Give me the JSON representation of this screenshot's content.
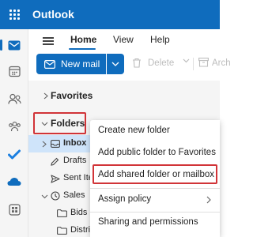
{
  "app": {
    "title": "Outlook"
  },
  "ribbon": {
    "tabs": [
      {
        "label": "Home",
        "selected": true
      },
      {
        "label": "View",
        "selected": false
      },
      {
        "label": "Help",
        "selected": false
      }
    ],
    "new_mail_label": "New mail",
    "delete_label": "Delete",
    "archive_label": "Arch"
  },
  "rail": {
    "items": [
      "mail-icon",
      "calendar-icon",
      "people-icon",
      "groups-icon",
      "todo-icon",
      "onedrive-icon",
      "apps-icon"
    ]
  },
  "folders": {
    "favorites_label": "Favorites",
    "folders_label": "Folders",
    "items": [
      {
        "label": "Inbox",
        "icon": "inbox-icon",
        "selected": true
      },
      {
        "label": "Drafts",
        "icon": "pencil-icon"
      },
      {
        "label": "Sent Items",
        "icon": "send-icon"
      },
      {
        "label": "Sales",
        "icon": "clock-icon"
      },
      {
        "label": "Bids - G",
        "icon": "folder-icon"
      },
      {
        "label": "Distribu",
        "icon": "folder-icon"
      }
    ]
  },
  "context_menu": {
    "items": [
      {
        "label": "Create new folder"
      },
      {
        "label": "Add public folder to Favorites"
      },
      {
        "label": "Add shared folder or mailbox",
        "highlighted": true
      },
      {
        "label": "Assign policy",
        "has_submenu": true
      },
      {
        "label": "Sharing and permissions"
      }
    ]
  },
  "colors": {
    "accent": "#0f6cbd",
    "highlight": "#d13438"
  }
}
